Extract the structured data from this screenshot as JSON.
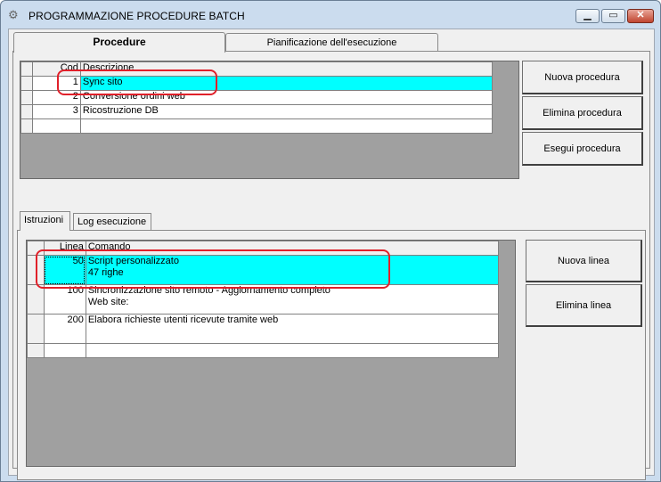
{
  "window": {
    "title": "PROGRAMMAZIONE PROCEDURE BATCH",
    "minimize_label": "▁",
    "maximize_label": "▭",
    "close_label": "✕"
  },
  "outer_tabs": [
    {
      "label": "Procedure",
      "active": true
    },
    {
      "label": "Pianificazione dell'esecuzione",
      "active": false
    }
  ],
  "procedures": {
    "columns": [
      "Cod",
      "Descrizione"
    ],
    "rows": [
      {
        "cod": "1",
        "descrizione": "Sync sito",
        "selected": true
      },
      {
        "cod": "2",
        "descrizione": "Conversione ordini web",
        "selected": false
      },
      {
        "cod": "3",
        "descrizione": "Ricostruzione DB",
        "selected": false
      }
    ],
    "buttons": {
      "new": "Nuova procedura",
      "delete": "Elimina procedura",
      "run": "Esegui procedura"
    }
  },
  "inner_tabs": [
    {
      "label": "Istruzioni",
      "active": true
    },
    {
      "label": "Log esecuzione",
      "active": false
    }
  ],
  "instructions": {
    "columns": [
      "Linea",
      "Comando"
    ],
    "rows": [
      {
        "linea": "50",
        "comando_line1": "Script personalizzato",
        "comando_line2": "47 righe",
        "selected": true
      },
      {
        "linea": "100",
        "comando_line1": "Sincronizzazione sito remoto - Aggiornamento completo",
        "comando_line2": "Web site:",
        "selected": false
      },
      {
        "linea": "200",
        "comando_line1": "Elabora richieste utenti ricevute tramite web",
        "comando_line2": "",
        "selected": false
      }
    ],
    "buttons": {
      "new": "Nuova linea",
      "delete": "Elimina linea"
    }
  },
  "colors": {
    "selection": "#00ffff",
    "annotation": "#e0202a",
    "grid_background": "#a0a0a0"
  }
}
